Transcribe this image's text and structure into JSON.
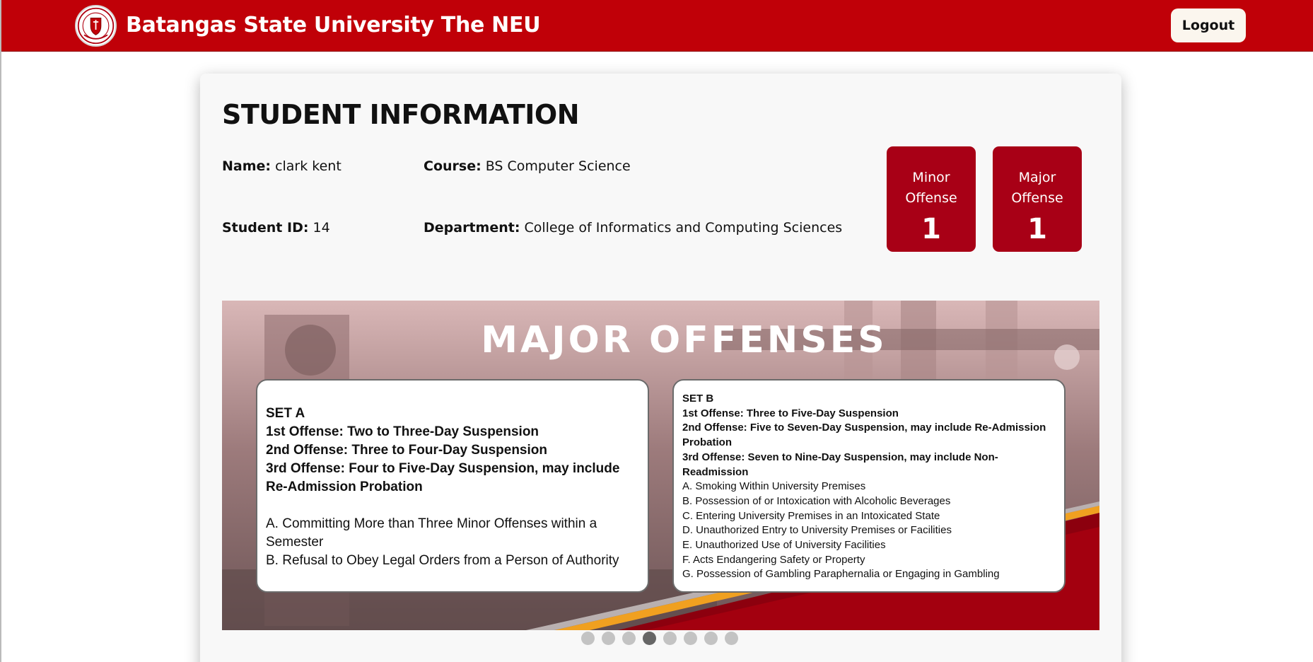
{
  "header": {
    "title": "Batangas State University The NEU",
    "logout_label": "Logout",
    "brand_color": "#c00008"
  },
  "student": {
    "heading": "STUDENT INFORMATION",
    "name_label": "Name:",
    "name_value": "clark kent",
    "id_label": "Student ID:",
    "id_value": "14",
    "course_label": "Course:",
    "course_value": "BS Computer Science",
    "department_label": "Department:",
    "department_value": "College of Informatics and Computing Sciences"
  },
  "offenses": {
    "minor_label": "Minor\nOffense",
    "minor_count": "1",
    "major_label": "Major\nOffense",
    "major_count": "1",
    "box_color": "#a80016"
  },
  "slide": {
    "title": "MAJOR OFFENSES",
    "set_a": {
      "heading": "SET A",
      "penalties": [
        "1st Offense: Two to Three-Day Suspension",
        "2nd Offense: Three to Four-Day Suspension",
        "3rd Offense: Four to Five-Day Suspension, may include Re-Admission Probation"
      ],
      "items": [
        "A. Committing More than Three Minor Offenses within a Semester",
        "B. Refusal to Obey Legal Orders from a Person of Authority"
      ]
    },
    "set_b": {
      "heading": "SET B",
      "penalties": [
        "1st Offense: Three to Five-Day Suspension",
        "2nd Offense: Five to Seven-Day Suspension, may include Re-Admission Probation",
        "3rd Offense: Seven to Nine-Day Suspension, may include Non-Readmission"
      ],
      "items": [
        "A. Smoking Within University Premises",
        "B. Possession of or Intoxication with Alcoholic Beverages",
        "C. Entering University Premises in an Intoxicated State",
        "D. Unauthorized Entry to University Premises or Facilities",
        "E. Unauthorized Use of University Facilities",
        "F. Acts Endangering Safety or Property",
        "G. Possession of Gambling Paraphernalia or Engaging in Gambling"
      ]
    }
  },
  "carousel": {
    "slide_count": 8,
    "active_index": 3
  }
}
